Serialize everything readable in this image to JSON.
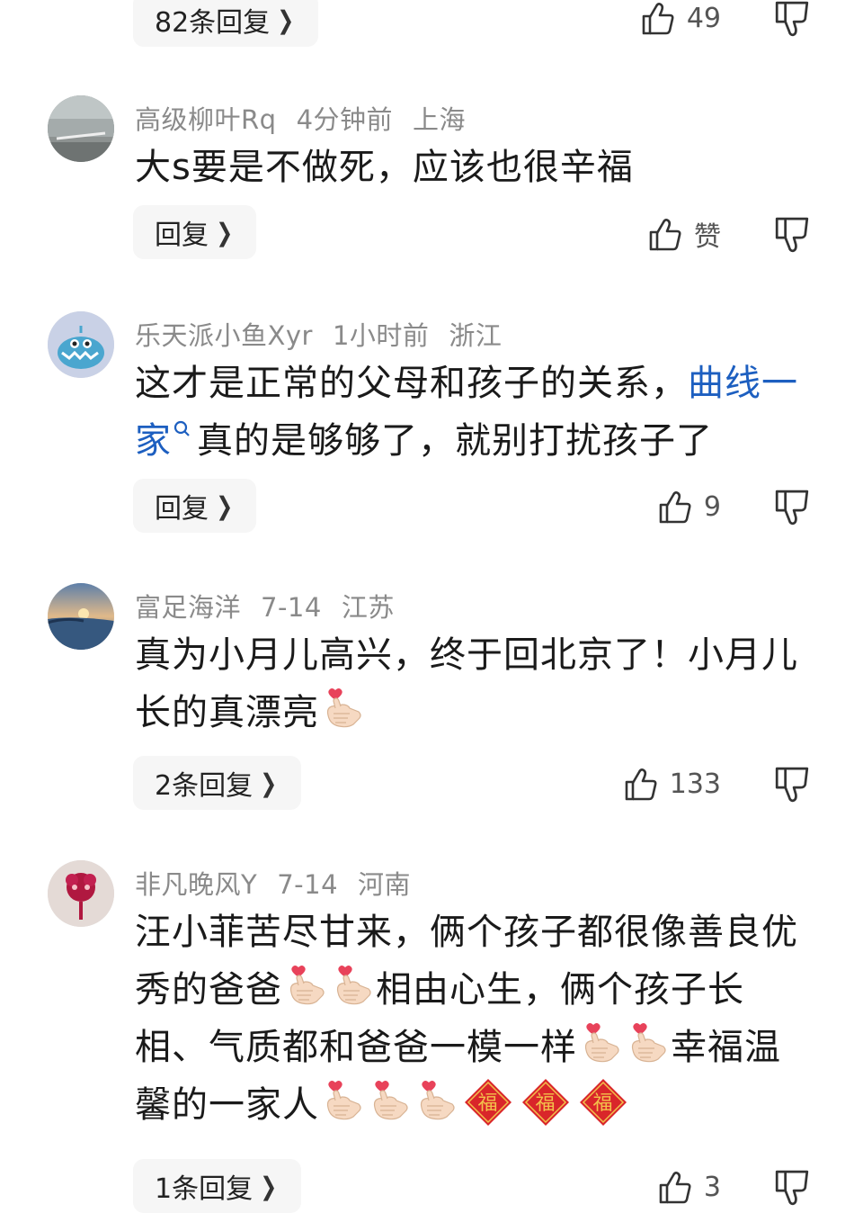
{
  "top": {
    "reply_label": "82条回复",
    "likes": "49"
  },
  "comments": [
    {
      "user": "高级柳叶Rq",
      "time": "4分钟前",
      "location": "上海",
      "text": "大s要是不做死，应该也很辛福",
      "reply_label": "回复",
      "likes": "赞"
    },
    {
      "user": "乐天派小鱼Xyr",
      "time": "1小时前",
      "location": "浙江",
      "text_a": "这才是正常的父母和孩子的关系，",
      "link": "曲线一家",
      "text_b": "真的是够够了，就别打扰孩子了",
      "reply_label": "回复",
      "likes": "9"
    },
    {
      "user": "富足海洋",
      "time": "7-14",
      "location": "江苏",
      "text_a": "真为小月儿高兴，终于回北京了！小月儿长的真漂亮",
      "reply_label": "2条回复",
      "likes": "133"
    },
    {
      "user": "非凡晚风Y",
      "time": "7-14",
      "location": "河南",
      "text_a": "汪小菲苦尽甘来，俩个孩子都很像善良优秀的爸爸",
      "text_b": "相由心生，俩个孩子长相、气质都和爸爸一模一样",
      "text_c": "幸福温馨的一家人",
      "fu_char": "福",
      "reply_label": "1条回复",
      "likes": "3"
    }
  ],
  "icons": {
    "like": "thumbs-up-icon",
    "dislike": "thumbs-down-icon",
    "chevron": "chevron-right-icon",
    "search": "search-icon",
    "heart_hand": "finger-heart-icon",
    "fu": "fu-diamond-icon"
  },
  "colors": {
    "link": "#1d5fc0",
    "meta": "#8a8a8a",
    "fu_red": "#d9262a"
  }
}
